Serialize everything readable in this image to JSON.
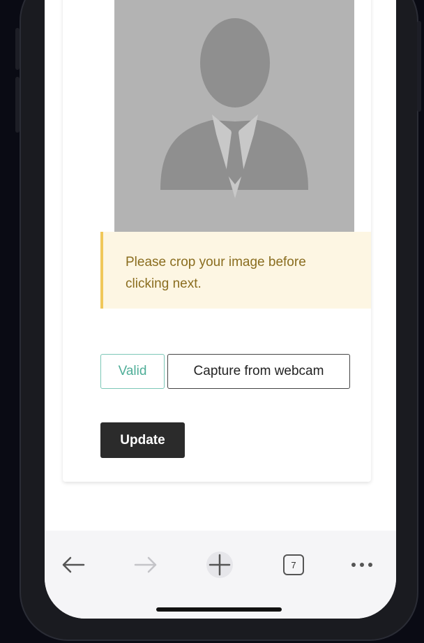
{
  "warning": {
    "line1": "Please crop your image before",
    "line2": "clicking next."
  },
  "buttons": {
    "valid_label": "Valid",
    "webcam_label": "Capture from webcam",
    "update_label": "Update"
  },
  "browser_toolbar": {
    "tab_count": "7"
  },
  "icons": {
    "avatar": "person-silhouette-icon",
    "back": "arrow-left-icon",
    "forward": "arrow-right-icon",
    "new_tab": "plus-icon",
    "tabs": "tab-counter-icon",
    "more": "ellipsis-icon"
  },
  "colors": {
    "warning_bg": "#fdf6e3",
    "warning_border": "#f0c85a",
    "valid_green": "#4fae98",
    "update_bg": "#2b2b2b"
  }
}
